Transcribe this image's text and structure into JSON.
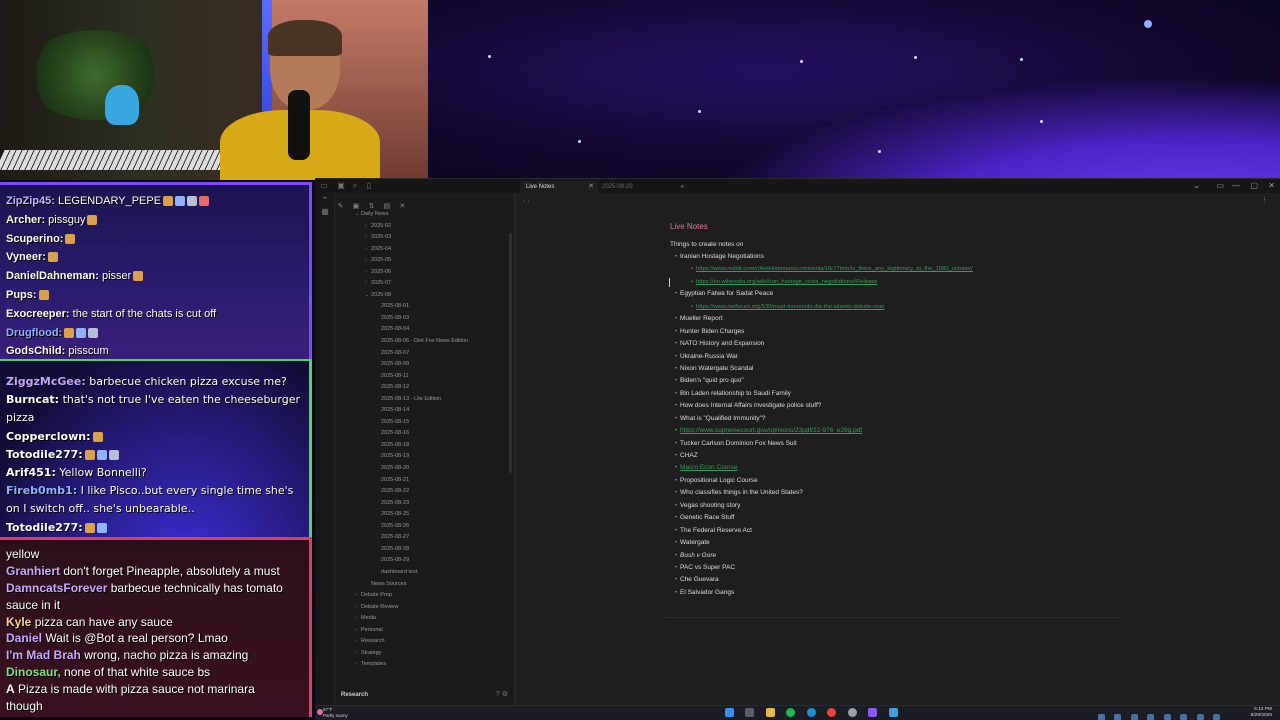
{
  "chat_top": [
    {
      "user": "ZipZip45:",
      "text": " LEGENDARY_PEPE",
      "color": "#c7b6ff",
      "emotes": 4
    },
    {
      "user": "Archer:",
      "text": " pissguy",
      "color": "#ffffff",
      "emotes": 1
    },
    {
      "user": "Scuperino:",
      "text": "",
      "color": "#ffffff",
      "emotes": 1
    },
    {
      "user": "Vyneer:",
      "text": "",
      "color": "#ffffff",
      "emotes": 1
    },
    {
      "user": "DanielDahneman:",
      "text": " pisser",
      "color": "#ffffff",
      "emotes": 1
    },
    {
      "user": "Pups:",
      "text": "",
      "color": "#ffffff",
      "emotes": 1
    },
    {
      "user": "Exocreeper:",
      "text": " the start of the chats is cut off",
      "color": "#ffffff",
      "emotes": 0
    },
    {
      "user": "Drugflood:",
      "text": "",
      "color": "#8fb3ff",
      "emotes": 3
    },
    {
      "user": "GodsChild:",
      "text": " pisscum",
      "color": "#ffffff",
      "emotes": 0
    }
  ],
  "chat_mid": [
    {
      "user": "ZiggzMcGee:",
      "text": "  barbecue chicken pizza excuse me?",
      "color": "#c4a6ff",
      "emotes": 0
    },
    {
      "user": "Burncat:",
      "text": "  that's not true I've eaten the cheeseburger",
      "color": "#ffffff",
      "emotes": 0
    },
    {
      "user": "",
      "text": "pizza",
      "color": "#ffffff",
      "emotes": 0
    },
    {
      "user": "Copperclown:",
      "text": "",
      "color": "#ffffff",
      "emotes": 1
    },
    {
      "user": "Totodile277:",
      "text": "",
      "color": "#ffffff",
      "emotes": 3
    },
    {
      "user": "Arif451:",
      "text": "  Yellow Bonnelli?",
      "color": "#ffffff",
      "emotes": 0
    },
    {
      "user": "Fireb0mb1:",
      "text": "  I like Pisco..but every single time she's",
      "color": "#8fb3ff",
      "emotes": 0
    },
    {
      "user": "",
      "text": "on I switch off.. she's unbearable..",
      "color": "#ffffff",
      "emotes": 0
    },
    {
      "user": "Totodile277:",
      "text": "",
      "color": "#ffffff",
      "emotes": 2
    }
  ],
  "chat_bottom": [
    {
      "user": "",
      "text": "yellow",
      "color": "#ffffff"
    },
    {
      "user": "Granhiert",
      "text": " don't forget Pineapple, absolutely a must",
      "color": "#c9a8ff"
    },
    {
      "user": "DamncatsForever",
      "text": " barbecue technically has tomato",
      "color": "#c9a8ff"
    },
    {
      "user": "",
      "text": "sauce in it",
      "color": "#ffffff"
    },
    {
      "user": "Kyle",
      "text": " pizza can have any sauce",
      "color": "#ffd38a"
    },
    {
      "user": "Daniel",
      "text": " Wait is @Bot a real person? Lmao",
      "color": "#c9a8ff"
    },
    {
      "user": "I'm Mad Brah",
      "text": " wrong, nacho pizza is amazing",
      "color": "#c9a8ff"
    },
    {
      "user": "Dinosaur,",
      "text": " none of that white sauce bs",
      "color": "#7fe07f"
    },
    {
      "user": "A",
      "text": " Pizza is made with pizza sauce not marinara",
      "color": "#ffffff"
    },
    {
      "user": "",
      "text": "though",
      "color": "#ffffff"
    }
  ],
  "tabs": {
    "active": "Live Notes",
    "second": "2025-08-29",
    "new_tab": "+"
  },
  "sidebar": {
    "tree": [
      {
        "label": "Daily News",
        "level": 0,
        "chev": "⌄"
      },
      {
        "label": "2025-02",
        "level": 1,
        "chev": "›"
      },
      {
        "label": "2025-03",
        "level": 1,
        "chev": "›"
      },
      {
        "label": "2025-04",
        "level": 1,
        "chev": "›"
      },
      {
        "label": "2025-05",
        "level": 1,
        "chev": "›"
      },
      {
        "label": "2025-06",
        "level": 1,
        "chev": "›"
      },
      {
        "label": "2025-07",
        "level": 1,
        "chev": "›"
      },
      {
        "label": "2025-08",
        "level": 1,
        "chev": "⌄"
      },
      {
        "label": "2025-08-01",
        "level": 2,
        "chev": ""
      },
      {
        "label": "2025-08-03",
        "level": 2,
        "chev": ""
      },
      {
        "label": "2025-08-04",
        "level": 2,
        "chev": ""
      },
      {
        "label": "2025-08-06 - Diet Fox News Edition",
        "level": 2,
        "chev": ""
      },
      {
        "label": "2025-08-07",
        "level": 2,
        "chev": ""
      },
      {
        "label": "2025-08-09",
        "level": 2,
        "chev": ""
      },
      {
        "label": "2025-08-11",
        "level": 2,
        "chev": ""
      },
      {
        "label": "2025-08-12",
        "level": 2,
        "chev": ""
      },
      {
        "label": "2025-08-13 - Lite Edition",
        "level": 2,
        "chev": ""
      },
      {
        "label": "2025-08-14",
        "level": 2,
        "chev": ""
      },
      {
        "label": "2025-08-15",
        "level": 2,
        "chev": ""
      },
      {
        "label": "2025-08-16",
        "level": 2,
        "chev": ""
      },
      {
        "label": "2025-08-18",
        "level": 2,
        "chev": ""
      },
      {
        "label": "2025-08-19",
        "level": 2,
        "chev": ""
      },
      {
        "label": "2025-08-20",
        "level": 2,
        "chev": ""
      },
      {
        "label": "2025-08-21",
        "level": 2,
        "chev": ""
      },
      {
        "label": "2025-08-22",
        "level": 2,
        "chev": ""
      },
      {
        "label": "2025-08-23",
        "level": 2,
        "chev": ""
      },
      {
        "label": "2025-08-25",
        "level": 2,
        "chev": ""
      },
      {
        "label": "2025-08-26",
        "level": 2,
        "chev": ""
      },
      {
        "label": "2025-08-27",
        "level": 2,
        "chev": ""
      },
      {
        "label": "2025-08-28",
        "level": 2,
        "chev": ""
      },
      {
        "label": "2025-08-29",
        "level": 2,
        "chev": ""
      },
      {
        "label": "dashboard test",
        "level": 2,
        "chev": ""
      },
      {
        "label": "News Sources",
        "level": 1,
        "chev": ""
      },
      {
        "label": "Debate Prep",
        "level": 0,
        "chev": "›"
      },
      {
        "label": "Debate Review",
        "level": 0,
        "chev": "›"
      },
      {
        "label": "Media",
        "level": 0,
        "chev": "›"
      },
      {
        "label": "Personal",
        "level": 0,
        "chev": "›"
      },
      {
        "label": "Research",
        "level": 0,
        "chev": "›"
      },
      {
        "label": "Strategy",
        "level": 0,
        "chev": "›"
      },
      {
        "label": "Templates",
        "level": 0,
        "chev": "›"
      }
    ],
    "vault_name": "Research"
  },
  "note": {
    "title": "Live Notes",
    "heading": "Things to create notes on",
    "items": [
      {
        "text": "Iranian Hostage Negotiations",
        "sub": false,
        "link": false
      },
      {
        "text": "https://www.reddit.com/r/AskHistorians/comments/16r77mm/is_there_any_legitimacy_to_the_1980_october/",
        "sub": true,
        "link": true
      },
      {
        "text": "https://en.wikipedia.org/wiki/Iran_hostage_crisis_negotiations#Release",
        "sub": true,
        "link": true
      },
      {
        "text": "Egyptian Fatwa for Sadat Peace",
        "sub": false,
        "link": false
      },
      {
        "text": "https://www.meforum.org/530/must-innocents-die-the-islamic-debate-over",
        "sub": true,
        "link": true
      },
      {
        "text": "Mueller Report",
        "sub": false,
        "link": false
      },
      {
        "text": "Hunter Biden Charges",
        "sub": false,
        "link": false
      },
      {
        "text": "NATO History and Expansion",
        "sub": false,
        "link": false
      },
      {
        "text": "Ukraine-Russia War",
        "sub": false,
        "link": false
      },
      {
        "text": "Nixon Watergate Scandal",
        "sub": false,
        "link": false
      },
      {
        "text": "Biden's \"quid pro quo\"",
        "sub": false,
        "link": false
      },
      {
        "text": "Bin Laden relationship to Saudi Family",
        "sub": false,
        "link": false
      },
      {
        "text": "How does Internal Affairs investigate police stuff?",
        "sub": false,
        "link": false
      },
      {
        "text": "What is \"Qualified Immunity\"?",
        "sub": false,
        "link": false
      },
      {
        "text": "https://www.supremecourt.gov/opinions/23pdf/22-976_e29g.pdf",
        "sub": false,
        "link": true
      },
      {
        "text": "Tucker Carlson Dominion Fox News Suit",
        "sub": false,
        "link": false
      },
      {
        "text": "CHAZ",
        "sub": false,
        "link": false
      },
      {
        "text": "Macro Econ Course",
        "sub": false,
        "link": true
      },
      {
        "text": "Propositional Logic Course",
        "sub": false,
        "link": false
      },
      {
        "text": "Who classifies things in the United States?",
        "sub": false,
        "link": false
      },
      {
        "text": "Vegas shooting story",
        "sub": false,
        "link": false
      },
      {
        "text": "Genetic Race Stuff",
        "sub": false,
        "link": false
      },
      {
        "text": "The Federal Reserve Act",
        "sub": false,
        "link": false
      },
      {
        "text": "Watergate",
        "sub": false,
        "link": false
      },
      {
        "text": "Bush v Gore",
        "sub": false,
        "link": false,
        "italic": true
      },
      {
        "text": "PAC vs Super PAC",
        "sub": false,
        "link": false
      },
      {
        "text": "Che Guevara",
        "sub": false,
        "link": false
      },
      {
        "text": "El Salvador Gangs",
        "sub": false,
        "link": false
      }
    ]
  },
  "taskbar": {
    "weather_temp": "87°F",
    "weather_desc": "Partly sunny",
    "time": "5:13 PM",
    "date": "8/29/2025"
  }
}
